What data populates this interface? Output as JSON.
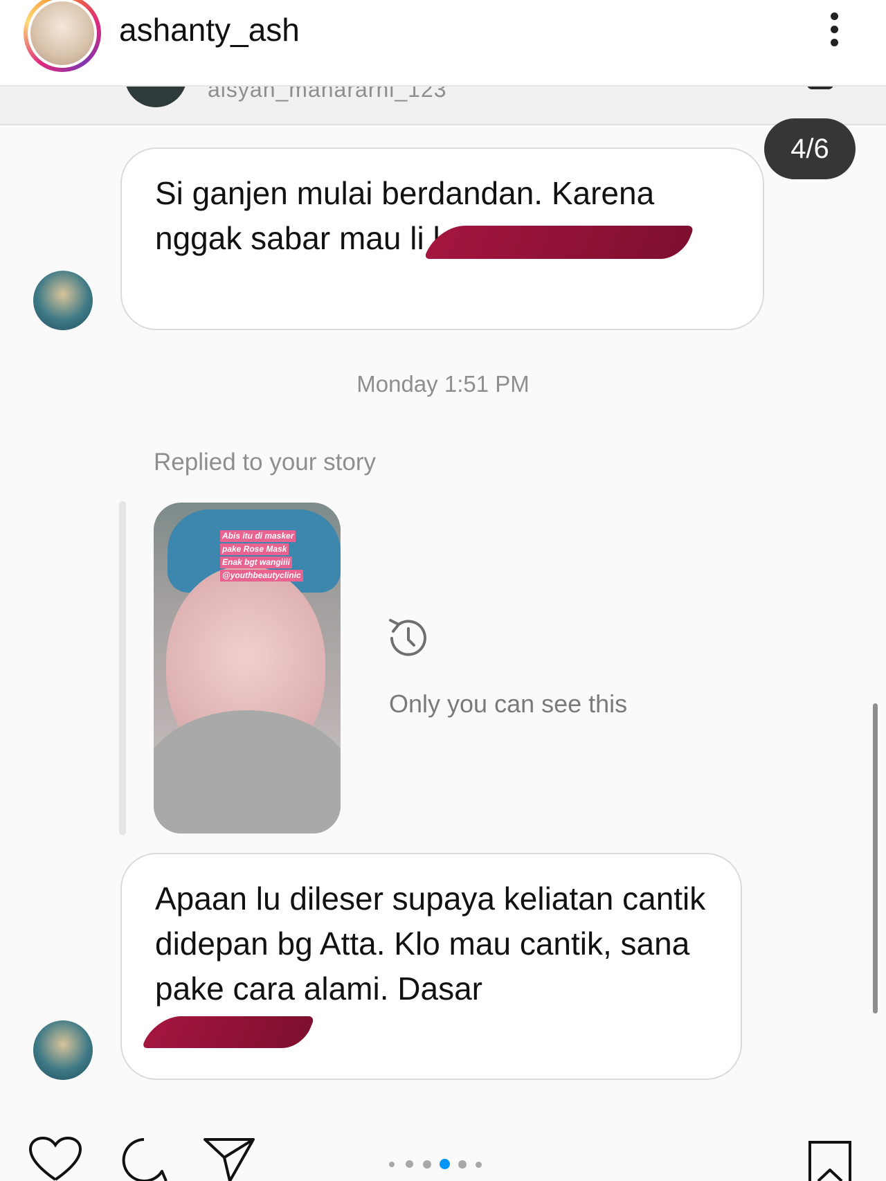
{
  "header": {
    "username": "ashanty_ash"
  },
  "previous_message": {
    "username_fragment": "aisyah_mahararni_123"
  },
  "carousel": {
    "counter": "4/6",
    "total_dots": 6,
    "active_index": 3
  },
  "messages": [
    {
      "text": "Si ganjen mulai berdandan. Karena nggak sabar mau li ke abg."
    },
    {
      "text": "Apaan lu dileser  supaya keliatan cantik didepan bg Atta. Klo mau cantik, sana pake cara alami. Dasar"
    }
  ],
  "timestamp": "Monday 1:51 PM",
  "story_reply": {
    "label": "Replied to your story",
    "caption_lines": [
      "Abis itu di masker",
      "pake Rose Mask",
      "Enak bgt wangiiii",
      "@youthbeautyclinic"
    ],
    "visibility_text": "Only you can see this"
  },
  "icons": {
    "more": "more-vertical-icon",
    "history": "history-icon",
    "like": "heart-icon",
    "comment": "comment-icon",
    "share": "paper-plane-icon",
    "save": "bookmark-icon"
  },
  "colors": {
    "redaction": "#9b1239",
    "counter_bg": "#363636",
    "dot_active": "#0095f6"
  }
}
